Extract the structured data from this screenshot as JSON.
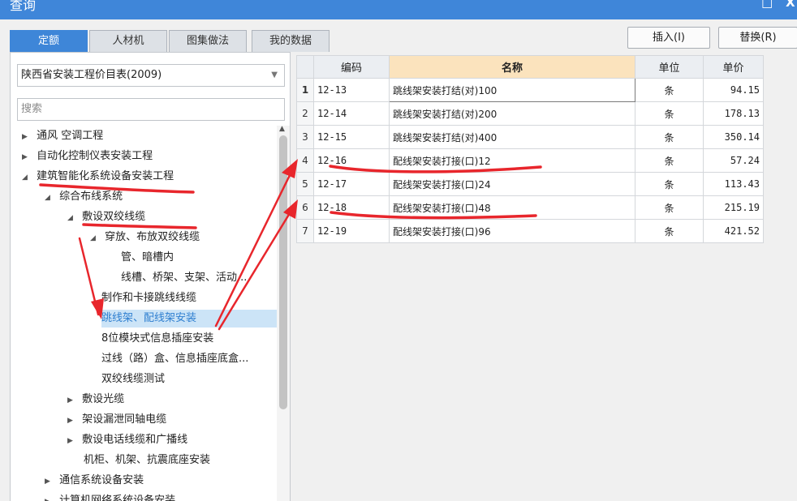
{
  "window": {
    "title": "查询",
    "minimize_glyph": "□",
    "close_glyph": "X"
  },
  "tabs": [
    {
      "label": "定额",
      "active": true
    },
    {
      "label": "人材机",
      "active": false
    },
    {
      "label": "图集做法",
      "active": false
    },
    {
      "label": "我的数据",
      "active": false
    }
  ],
  "toolbar": {
    "insert_label": "插入(I)",
    "replace_label": "替换(R)"
  },
  "library_select": {
    "value": "陕西省安装工程价目表(2009)"
  },
  "search": {
    "placeholder": "搜索"
  },
  "tree": [
    {
      "label": "通风 空调工程",
      "toggle": "▶"
    },
    {
      "label": "自动化控制仪表安装工程",
      "toggle": "▶"
    },
    {
      "label": "建筑智能化系统设备安装工程",
      "toggle": "◢"
    },
    {
      "label": "综合布线系统",
      "toggle": "◢"
    },
    {
      "label": "敷设双绞线缆",
      "toggle": "◢"
    },
    {
      "label": "穿放、布放双绞线缆",
      "toggle": "◢"
    },
    {
      "label": "管、暗槽内",
      "toggle": ""
    },
    {
      "label": "线槽、桥架、支架、活动...",
      "toggle": ""
    },
    {
      "label": "制作和卡接跳线线缆",
      "toggle": ""
    },
    {
      "label": "跳线架、配线架安装",
      "toggle": "",
      "selected": true
    },
    {
      "label": "8位模块式信息插座安装",
      "toggle": ""
    },
    {
      "label": "过线（路）盒、信息插座底盒...",
      "toggle": ""
    },
    {
      "label": "双绞线缆测试",
      "toggle": ""
    },
    {
      "label": "敷设光缆",
      "toggle": "▶"
    },
    {
      "label": "架设漏泄同轴电缆",
      "toggle": "▶"
    },
    {
      "label": "敷设电话线缆和广播线",
      "toggle": "▶"
    },
    {
      "label": "机柜、机架、抗震底座安装",
      "toggle": ""
    },
    {
      "label": "通信系统设备安装",
      "toggle": "▶"
    },
    {
      "label": "计算机网络系统设备安装",
      "toggle": "▶"
    }
  ],
  "table": {
    "columns": [
      "编码",
      "名称",
      "单位",
      "单价"
    ],
    "rows": [
      {
        "no": "1",
        "code": "12-13",
        "name": "跳线架安装打结(对)100",
        "unit": "条",
        "price": "94.15"
      },
      {
        "no": "2",
        "code": "12-14",
        "name": "跳线架安装打结(对)200",
        "unit": "条",
        "price": "178.13"
      },
      {
        "no": "3",
        "code": "12-15",
        "name": "跳线架安装打结(对)400",
        "unit": "条",
        "price": "350.14"
      },
      {
        "no": "4",
        "code": "12-16",
        "name": "配线架安装打接(口)12",
        "unit": "条",
        "price": "57.24"
      },
      {
        "no": "5",
        "code": "12-17",
        "name": "配线架安装打接(口)24",
        "unit": "条",
        "price": "113.43"
      },
      {
        "no": "6",
        "code": "12-18",
        "name": "配线架安装打接(口)48",
        "unit": "条",
        "price": "215.19"
      },
      {
        "no": "7",
        "code": "12-19",
        "name": "配线架安装打接(口)96",
        "unit": "条",
        "price": "421.52"
      }
    ]
  },
  "colors": {
    "accent": "#3e86d8",
    "annotation": "#e8262c",
    "selection": "#cce4f7",
    "header_highlight": "#fbe3bd"
  }
}
